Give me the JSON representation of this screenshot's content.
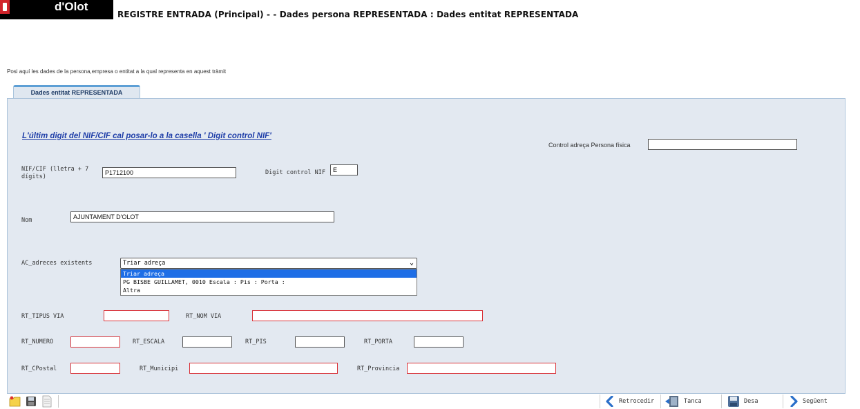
{
  "header": {
    "logo_text": "d'Olot",
    "title": "REGISTRE ENTRADA (Principal) - - Dades persona REPRESENTADA : Dades entitat REPRESENTADA"
  },
  "intro_text": "Posi aquí les dades de la persona,empresa o entitat a la qual representa en aquest tràmit",
  "tab": {
    "label": "Dades entitat REPRESENTADA"
  },
  "note": "L'últim digit del NIF/CIF  cal posar-lo a la casella ' Digit control NIF'",
  "fields": {
    "control_adreca": {
      "label": "Control adreça Persona física",
      "value": ""
    },
    "nif": {
      "label_line1": "NIF/CIF (lletra + 7",
      "label_line2": "dígits)",
      "value": "P1712100"
    },
    "digit_control": {
      "label": "Digit control NIF",
      "value": "E"
    },
    "nom": {
      "label": "Nom",
      "value": "AJUNTAMENT D'OLOT"
    },
    "adreces": {
      "label": "AC_adreces existents",
      "selected": "Triar adreça",
      "options": [
        "Triar adreça",
        "PG BISBE GUILLAMET, 0010 Escala : Pis : Porta :",
        "Altra"
      ]
    },
    "tipus_via": {
      "label": "RT_TIPUS VIA",
      "value": ""
    },
    "nom_via": {
      "label": "RT_NOM VIA",
      "value": ""
    },
    "numero": {
      "label": "RT_NUMERO",
      "value": ""
    },
    "escala": {
      "label": "RT_ESCALA",
      "value": ""
    },
    "pis": {
      "label": "RT_PIS",
      "value": ""
    },
    "porta": {
      "label": "RT_PORTA",
      "value": ""
    },
    "cpostal": {
      "label": "RT_CPostal",
      "value": ""
    },
    "municipi": {
      "label": "RT_Municipi",
      "value": ""
    },
    "provincia": {
      "label": "RT_Provincia",
      "value": ""
    }
  },
  "toolbar": {
    "left_icons": [
      "new-folder-icon",
      "save-disk-icon",
      "document-icon"
    ],
    "retrocedir": "Retrocedir",
    "tanca": "Tanca",
    "desa": "Desa",
    "seguent": "Següent"
  },
  "colors": {
    "panel_bg": "#e3e9f1",
    "note_link": "#1f3ea8",
    "required_border": "#d9333a",
    "selected_option": "#1e6ee6",
    "toolbar_arrow": "#2a6fc9"
  }
}
